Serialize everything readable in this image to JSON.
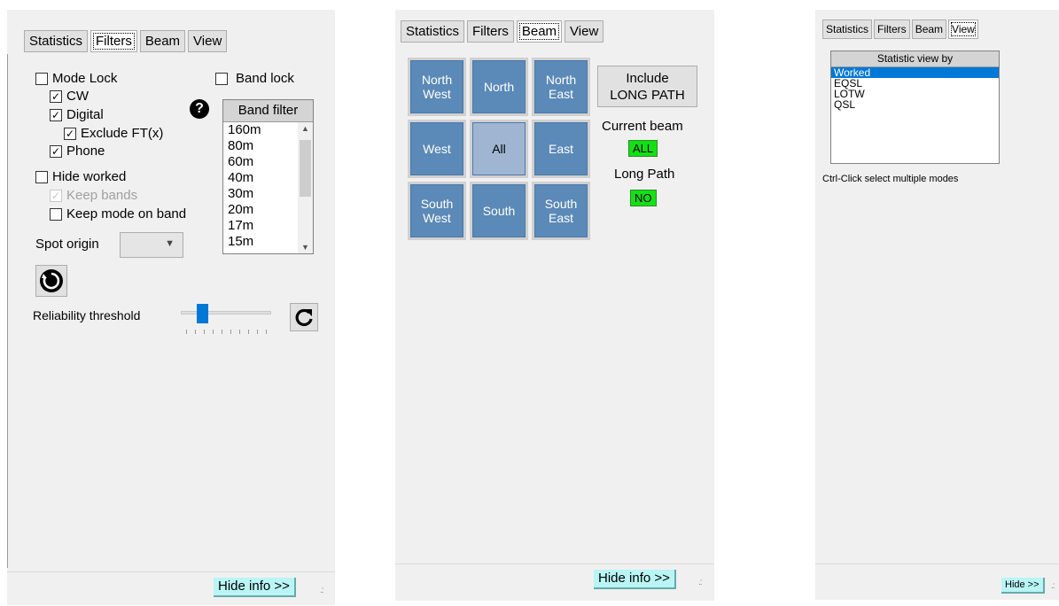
{
  "tabs": [
    "Statistics",
    "Filters",
    "Beam",
    "View"
  ],
  "filters_panel": {
    "active_tab": "Filters",
    "mode_lock": "Mode Lock",
    "cw": "CW",
    "digital": "Digital",
    "exclude_ft": "Exclude FT(x)",
    "phone": "Phone",
    "band_lock": "Band lock",
    "help_icon": "?",
    "band_filter_header": "Band filter",
    "bands": [
      "160m",
      "80m",
      "60m",
      "40m",
      "30m",
      "20m",
      "17m",
      "15m"
    ],
    "hide_worked": "Hide worked",
    "keep_bands": "Keep bands",
    "keep_mode_on_band": "Keep mode on band",
    "spot_origin_label": "Spot origin",
    "spot_origin_value": "",
    "reliability_label": "Reliability threshold",
    "reliability_level": 0.2,
    "hide_info": "Hide info >>"
  },
  "beam_panel": {
    "active_tab": "Beam",
    "directions": [
      "North\nWest",
      "North",
      "North\nEast",
      "West",
      "All",
      "East",
      "South\nWest",
      "South",
      "South\nEast"
    ],
    "include_long_path": "Include\nLONG PATH",
    "current_beam_label": "Current beam",
    "current_beam_value": "ALL",
    "long_path_label": "Long Path",
    "long_path_value": "NO",
    "hide_info": "Hide info >>"
  },
  "view_panel": {
    "active_tab": "View",
    "list_header": "Statistic view by",
    "items": [
      "Worked",
      "EQSL",
      "LOTW",
      "QSL"
    ],
    "selected": "Worked",
    "hint": "Ctrl-Click select multiple modes",
    "hide": "Hide >>"
  },
  "colors": {
    "panel_bg": "#f0f0f0",
    "beam_button": "#5b89b8",
    "beam_all": "#9fb5d2",
    "badge_green": "#13e013",
    "hide_button": "#b9f5f5",
    "selection": "#0078d7"
  }
}
